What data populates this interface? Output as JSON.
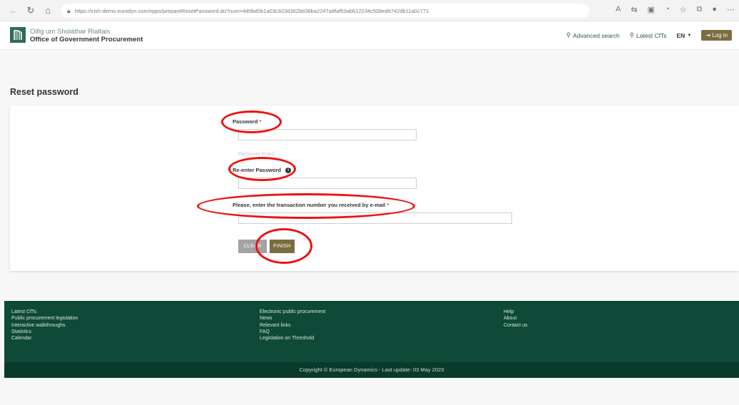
{
  "browser": {
    "url": "https://irish-demo.eurodyn.com/epps/prepareResetPassword.do?num=4d0bd0b1a03c923d362bb36ba2247a8faf53ab612234c508ed9742db11a0c771"
  },
  "header": {
    "org_irish": "Oifig um Sholáthar Rialtais",
    "org_english": "Office of Government Procurement",
    "advanced_search": "Advanced search",
    "latest_cfts": "Latest CfTs",
    "language": "EN",
    "login": "Log in"
  },
  "page": {
    "title": "Reset password"
  },
  "form": {
    "password_label": "Password",
    "required_mark": "*",
    "password_rules_hint": "Password Rules",
    "reenter_label": "Re-enter Password",
    "transaction_label": "Please, enter the transaction number you received by e-mail",
    "clear_button": "CLEAR",
    "finish_button": "FINISH"
  },
  "footer": {
    "col1": [
      "Latest CfTs",
      "Public procurement legislation",
      "Interactive walkthroughs",
      "Statistics",
      "Calendar"
    ],
    "col2": [
      "Electronic public procurement",
      "News",
      "Relevant links",
      "FAQ",
      "Legislation on Threshold"
    ],
    "col3": [
      "Help",
      "About",
      "Contact us"
    ],
    "copyright": "Copyright © European Dynamics - Last update: 03 May 2023"
  },
  "colors": {
    "brand_green": "#0e4a37",
    "button_olive": "#7a6d3f",
    "annotation_red": "#e11111"
  }
}
